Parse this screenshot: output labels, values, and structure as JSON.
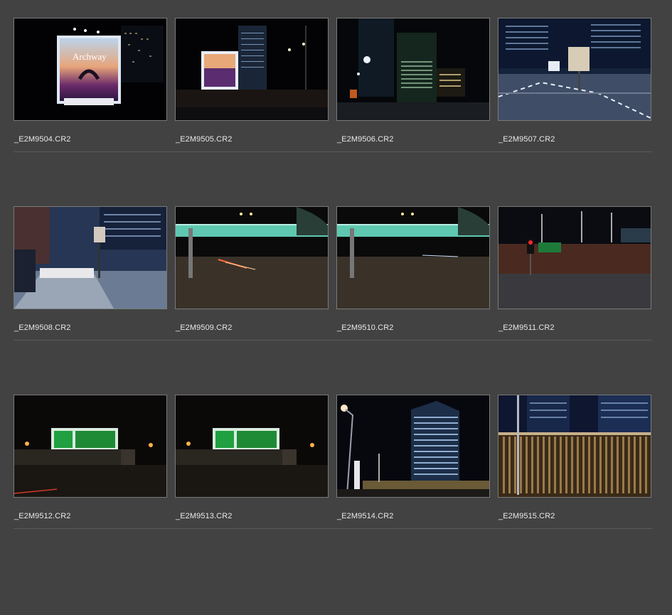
{
  "grid": {
    "rows": [
      [
        "_E2M9504.CR2",
        "_E2M9505.CR2",
        "_E2M9506.CR2",
        "_E2M9507.CR2"
      ],
      [
        "_E2M9508.CR2",
        "_E2M9509.CR2",
        "_E2M9510.CR2",
        "_E2M9511.CR2"
      ],
      [
        "_E2M9512.CR2",
        "_E2M9513.CR2",
        "_E2M9514.CR2",
        "_E2M9515.CR2"
      ]
    ]
  },
  "billboard_text": "Archway",
  "colors": {
    "background": "#424242",
    "divider": "#5a5a5a",
    "filename_text": "#e8e8e8"
  }
}
